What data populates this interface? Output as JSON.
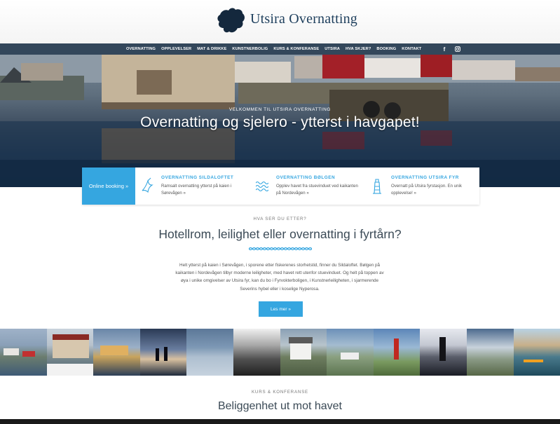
{
  "brand": {
    "name": "Utsira Overnatting"
  },
  "nav": {
    "items": [
      "OVERNATTING",
      "OPPLEVELSER",
      "MAT & DRIKKE",
      "KUNSTNERBOLIG",
      "KURS & KONFERANSE",
      "UTSIRA",
      "HVA SKJER?",
      "BOOKING",
      "KONTAKT"
    ],
    "social": {
      "facebook": "f"
    }
  },
  "hero": {
    "kicker": "VELKOMMEN TIL UTSIRA OVERNATTING",
    "title": "Overnatting og sjelero - ytterst i havgapet!"
  },
  "booking": {
    "button": "Online booking »",
    "items": [
      {
        "title": "OVERNATTING SILDALOFTET",
        "text": "Ramsalt overnatting ytterst på kaien i Sørevågen »",
        "icon": "seagull-icon"
      },
      {
        "title": "OVERNATTING BØLGEN",
        "text": "Opplev havet fra stuevinduet ved kaikanten på Nordevågen »",
        "icon": "waves-icon"
      },
      {
        "title": "OVERNATTING UTSIRA FYR",
        "text": "Overnatt på Utsira fyrstasjon. En unik opplevelse! »",
        "icon": "lighthouse-icon"
      }
    ]
  },
  "intro": {
    "kicker": "HVA SER DU ETTER?",
    "heading": "Hotellrom, leilighet eller overnatting i fyrtårn?",
    "text": "Helt ytterst på kaien i Sørevågen, i sporene etter fiskerenes storhetstid, finner du Sildaloftet. Bølgen på kaikanten i Nordevågen tilbyr moderne leiligheter, med havet rett utenfor stuevinduet. Og helt på toppen av øya i unike omgivelser av Utsira fyr, kan du bo i Fyrvokterboligen, i Kunstnerleiligheten, i sjarmerende Severins hybel eller i koselige Nyperosa.",
    "button": "Les mer »"
  },
  "gallery": {
    "photos": [
      "harbor-photo",
      "boathouse-photo",
      "waterfront-photo",
      "silhouette-photo",
      "sea-photo",
      "rocks-photo",
      "white-house-photo",
      "village-photo",
      "red-lighthouse-photo",
      "lighthouse-photo",
      "clouds-photo",
      "kayak-photo"
    ]
  },
  "section2": {
    "kicker": "KURS & KONFERANSE",
    "heading": "Beliggenhet ut mot havet"
  },
  "colors": {
    "accent": "#35a6e0",
    "nav": "#33475b",
    "logo": "#1d3e5c"
  }
}
